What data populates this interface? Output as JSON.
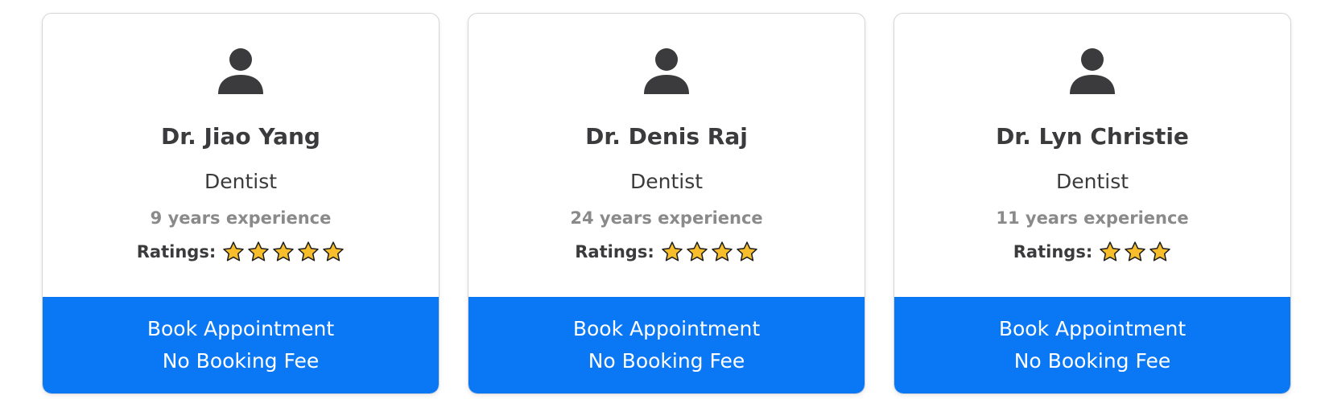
{
  "colors": {
    "button_bg": "#0a78f5",
    "star_fill": "#f7bd2a",
    "text_dark": "#3b3b3d",
    "text_muted": "#8a8a8a",
    "avatar": "#3b3b3d"
  },
  "cards": [
    {
      "avatar_icon": "person-icon",
      "name": "Dr. Jiao Yang",
      "specialty": "Dentist",
      "experience": "9 years experience",
      "ratings_label": "Ratings:",
      "rating": 5,
      "button_line1": "Book Appointment",
      "button_line2": "No Booking Fee"
    },
    {
      "avatar_icon": "person-icon",
      "name": "Dr. Denis Raj",
      "specialty": "Dentist",
      "experience": "24 years experience",
      "ratings_label": "Ratings:",
      "rating": 4,
      "button_line1": "Book Appointment",
      "button_line2": "No Booking Fee"
    },
    {
      "avatar_icon": "person-icon",
      "name": "Dr. Lyn Christie",
      "specialty": "Dentist",
      "experience": "11 years experience",
      "ratings_label": "Ratings:",
      "rating": 3,
      "button_line1": "Book Appointment",
      "button_line2": "No Booking Fee"
    }
  ]
}
